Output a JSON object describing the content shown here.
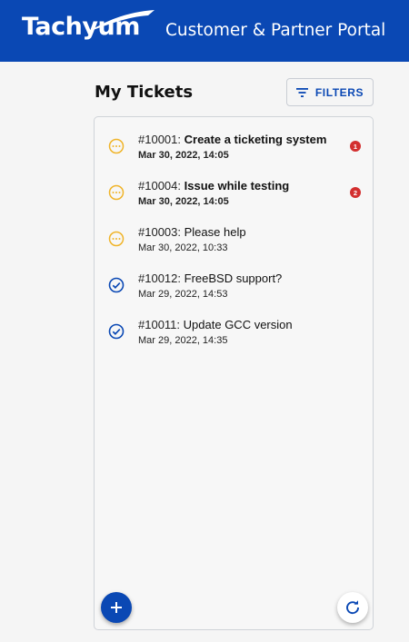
{
  "header": {
    "brand": "Tachyum",
    "portal_title": "Customer & Partner Portal",
    "color": "#0a48b4"
  },
  "page": {
    "title": "My Tickets",
    "filters_label": "FILTERS"
  },
  "tickets": [
    {
      "id": "#10001:",
      "title": "Create a ticketing system",
      "date": "Mar 30, 2022, 14:05",
      "status": "pending",
      "unread": true,
      "badge": "1"
    },
    {
      "id": "#10004:",
      "title": "Issue while testing",
      "date": "Mar 30, 2022, 14:05",
      "status": "pending",
      "unread": true,
      "badge": "2"
    },
    {
      "id": "#10003:",
      "title": "Please help",
      "date": "Mar 30, 2022, 10:33",
      "status": "pending",
      "unread": false,
      "badge": null
    },
    {
      "id": "#10012:",
      "title": "FreeBSD support?",
      "date": "Mar 29, 2022, 14:53",
      "status": "resolved",
      "unread": false,
      "badge": null
    },
    {
      "id": "#10011:",
      "title": "Update GCC version",
      "date": "Mar 29, 2022, 14:35",
      "status": "resolved",
      "unread": false,
      "badge": null
    }
  ],
  "icons": {
    "pending": "pending-icon",
    "resolved": "check-circle-icon",
    "add": "add-icon",
    "refresh": "refresh-icon",
    "filter": "filter-icon"
  },
  "colors": {
    "pending": "#f0b429",
    "resolved": "#0a48b4",
    "badge": "#d32f2f"
  }
}
